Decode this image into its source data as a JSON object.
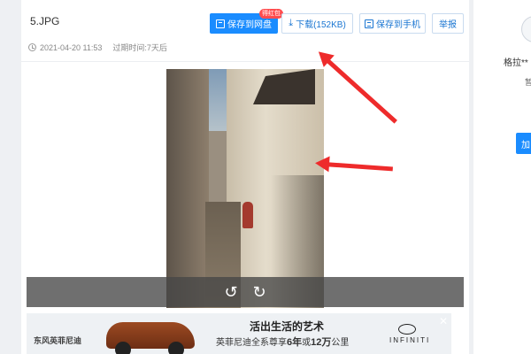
{
  "file": {
    "name": "5.JPG",
    "date": "2021-04-20 11:53",
    "expiry_label": "过期时间:",
    "expiry_value": "7天后"
  },
  "toolbar": {
    "save_label": "保存到网盘",
    "save_badge": "得红包",
    "download_label": "下载(152KB)",
    "phone_label": "保存到手机",
    "report_label": "举报"
  },
  "viewer": {
    "rotate_left_icon": "rotate-left-icon",
    "rotate_right_icon": "rotate-right-icon"
  },
  "ad": {
    "logo": "东风英菲尼迪",
    "title": "活出生活的艺术",
    "line_prefix": "英菲尼迪全系尊享",
    "line_years": "6年",
    "line_or": "或",
    "line_km": "12万",
    "line_suffix": "公里",
    "brand": "INFINITI",
    "close": "✕"
  },
  "sidebar": {
    "user_name": "格拉**",
    "sub_text": "暂",
    "button_label": "加"
  },
  "colors": {
    "accent": "#1a8cff",
    "arrow": "#ee2b2b",
    "badge": "#ff4d4f"
  }
}
